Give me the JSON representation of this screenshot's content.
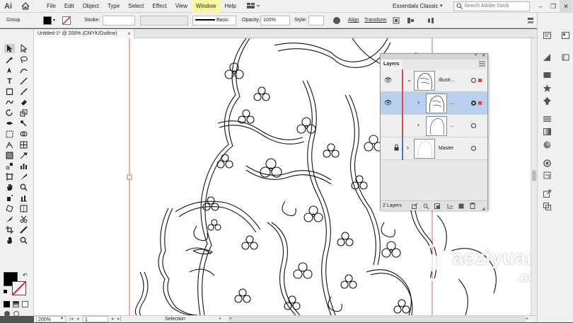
{
  "menubar": {
    "logo": "Ai",
    "items": [
      "File",
      "Edit",
      "Object",
      "Type",
      "Select",
      "Effect",
      "View",
      "Window",
      "Help"
    ],
    "workspace": "Essentials Classic",
    "search_placeholder": "Search Adobe Stock"
  },
  "controlbar": {
    "selection_label": "Group",
    "stroke_label": "Stroke:",
    "brush_label": "Basic",
    "opacity_label": "Opacity:",
    "opacity_value": "100%",
    "style_label": "Style:",
    "align_label": "Align",
    "transform_label": "Transform"
  },
  "document": {
    "tab_title": "Untitled-1* @ 200% (CMYK/Outline)",
    "close_glyph": "×"
  },
  "layers_panel": {
    "title": "Layers",
    "layers": [
      {
        "name": "Illustr...",
        "visible": true,
        "locked": false,
        "expanded": true,
        "color": "#e0464b"
      },
      {
        "name": "...",
        "visible": true,
        "locked": false,
        "expanded": false,
        "selected": true,
        "color": "#e0464b"
      },
      {
        "name": "...",
        "visible": false,
        "locked": false,
        "expanded": false,
        "color": "#e0464b"
      },
      {
        "name": "Master",
        "visible": false,
        "locked": true,
        "expanded": false,
        "color": "#4a6fe0"
      }
    ],
    "footer_count": "2 Layers"
  },
  "status": {
    "zoom": "200%",
    "artboard": "1",
    "tool": "Selection"
  },
  "watermark": {
    "line1": "aeziyuan",
    "line2": ".com"
  },
  "colors": {
    "selection_accent": "#b9cfee",
    "layer_red": "#e0464b",
    "layer_blue": "#4a6fe0",
    "artboard_guide": "#e06060"
  }
}
